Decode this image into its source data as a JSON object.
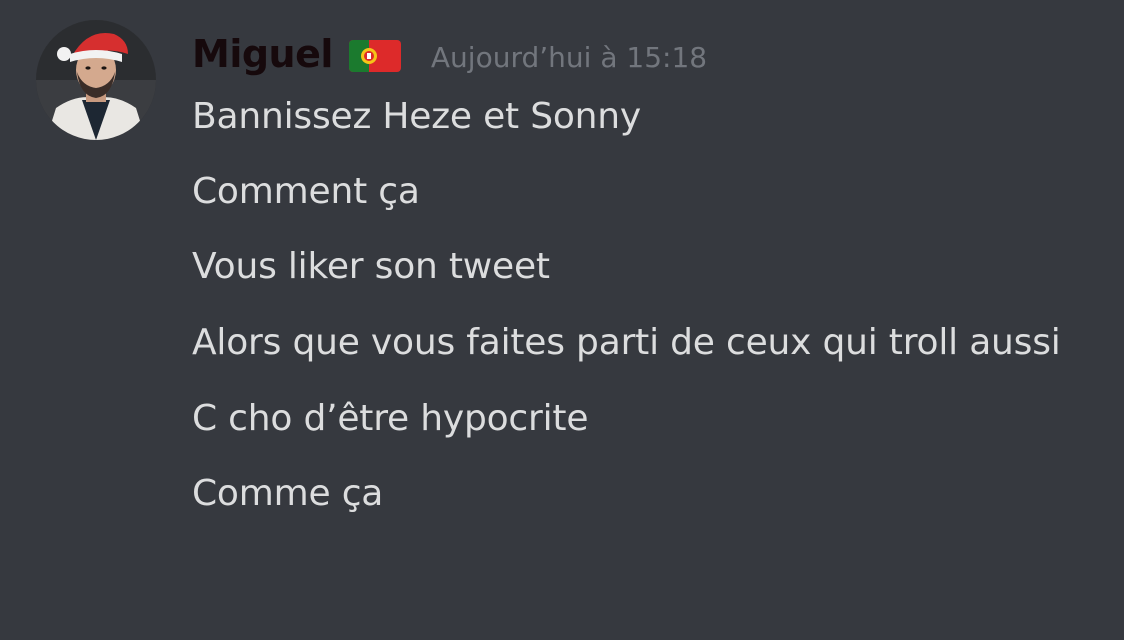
{
  "message": {
    "author": {
      "name": "Miguel",
      "badge_icon": "portugal-flag-icon",
      "avatar": "user-avatar"
    },
    "timestamp": "Aujourd’hui à 15:18",
    "lines": [
      "Bannissez Heze et Sonny",
      "Comment ça",
      "Vous liker son tweet",
      "Alors que vous faites parti de ceux qui troll aussi",
      "C cho d’être hypocrite",
      "Comme ça"
    ]
  },
  "colors": {
    "background": "#36393f",
    "username": "#16090c",
    "message_text": "#dcddde",
    "timestamp": "#72767d"
  }
}
